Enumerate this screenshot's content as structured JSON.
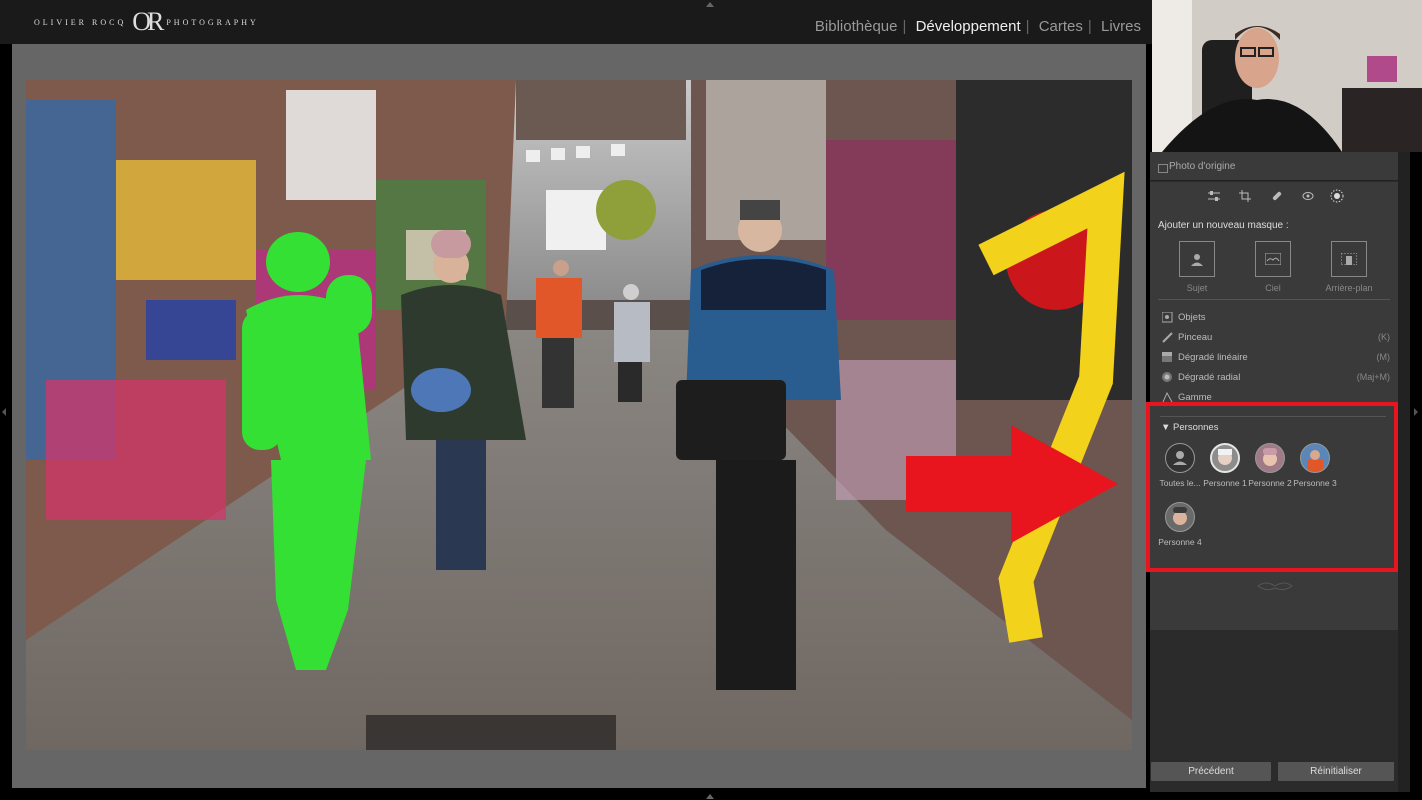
{
  "logo": {
    "left": "OLIVIER ROCQ",
    "mark": "OR",
    "right": "PHOTOGRAPHY"
  },
  "modules": [
    {
      "label": "Bibliothèque",
      "active": false
    },
    {
      "label": "Développement",
      "active": true
    },
    {
      "label": "Cartes",
      "active": false
    },
    {
      "label": "Livres",
      "active": false
    }
  ],
  "panel": {
    "origin_label": "Photo d'origine",
    "toolbar_icons": [
      "sliders-icon",
      "crop-icon",
      "healing-icon",
      "redeye-icon",
      "mask-icon"
    ],
    "masks_title": "Ajouter un nouveau masque :",
    "mask_buttons": [
      {
        "label": "Sujet",
        "icon": "subject-icon"
      },
      {
        "label": "Ciel",
        "icon": "sky-icon"
      },
      {
        "label": "Arrière-plan",
        "icon": "background-icon"
      }
    ],
    "tools": [
      {
        "label": "Objets",
        "key": ""
      },
      {
        "label": "Pinceau",
        "key": "(K)"
      },
      {
        "label": "Dégradé linéaire",
        "key": "(M)"
      },
      {
        "label": "Dégradé radial",
        "key": "(Maj+M)"
      },
      {
        "label": "Gamme",
        "key": ""
      }
    ],
    "persons_title": "Personnes",
    "persons": [
      {
        "label": "Toutes le...",
        "selected": false
      },
      {
        "label": "Personne 1",
        "selected": true
      },
      {
        "label": "Personne 2",
        "selected": false
      },
      {
        "label": "Personne 3",
        "selected": false
      },
      {
        "label": "Personne 4",
        "selected": false
      }
    ],
    "buttons": {
      "previous": "Précédent",
      "reset": "Réinitialiser"
    }
  },
  "colors": {
    "highlight_box": "#e8141e",
    "mask_overlay": "#33e033",
    "arrow": "#e8141e"
  }
}
